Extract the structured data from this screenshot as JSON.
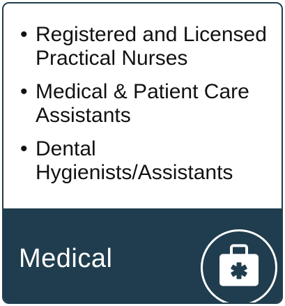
{
  "list": {
    "items": [
      {
        "label": "Registered and Licensed Practical Nurses"
      },
      {
        "label": "Medical & Patient Care Assistants"
      },
      {
        "label": "Dental Hygienists/Assistants"
      }
    ],
    "bullet": "•"
  },
  "footer": {
    "title": "Medical",
    "icon": "medical-kit-icon"
  },
  "colors": {
    "accent": "#1f3d4e",
    "text": "#111111",
    "footer_text": "#ffffff"
  }
}
